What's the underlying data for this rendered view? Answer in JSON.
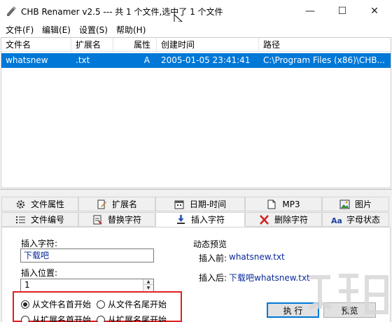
{
  "window": {
    "title": "CHB Renamer v2.5 --- 共 1 个文件,选中了 1 个文件",
    "minimize": "—",
    "maximize": "☐",
    "close": "✕"
  },
  "menu": [
    "文件(F)",
    "编辑(E)",
    "设置(S)",
    "帮助(H)"
  ],
  "list": {
    "columns": [
      "文件名",
      "扩展名",
      "属性",
      "创建时间",
      "路径"
    ],
    "rows": [
      {
        "name": "whatsnew",
        "ext": ".txt",
        "attr": "A",
        "created": "2005-01-05 23:41:41",
        "path": "C:\\Program Files (x86)\\CHB..."
      }
    ]
  },
  "tabs": {
    "row1": [
      "文件属性",
      "扩展名",
      "日期-时间",
      "MP3",
      "图片"
    ],
    "row2": [
      "文件编号",
      "替换字符",
      "插入字符",
      "删除字符",
      "字母状态"
    ],
    "active": "插入字符"
  },
  "panel": {
    "insert_label": "插入字符:",
    "insert_value": "下载吧",
    "position_label": "插入位置:",
    "position_value": "1",
    "radios": [
      "从文件名首开始",
      "从文件名尾开始",
      "从扩展名首开始",
      "从扩展名尾开始"
    ],
    "preview_title": "动态预览",
    "before_label": "插入前:",
    "before_value": "whatsnew.txt",
    "after_label": "插入后:",
    "after_value": "下载吧whatsnew.txt",
    "execute_label": "执 行",
    "preview_label": "预览"
  },
  "colors": {
    "selection": "#0078d7",
    "highlight_border": "#e02020",
    "value_text": "#0a2a9a"
  }
}
